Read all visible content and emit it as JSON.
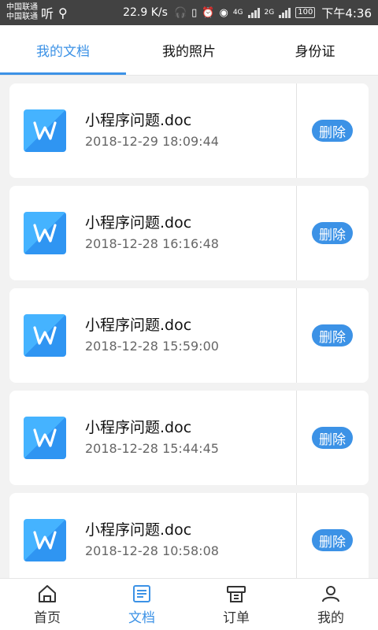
{
  "status_bar": {
    "carrier_1": "中国联通",
    "carrier_2": "中国联通",
    "extra_text": "听",
    "speed": "22.9 K/s",
    "network_1": "4G",
    "network_2": "2G",
    "battery": "100",
    "time": "下午4:36"
  },
  "tabs": [
    {
      "label": "我的文档",
      "active": true
    },
    {
      "label": "我的照片",
      "active": false
    },
    {
      "label": "身份证",
      "active": false
    }
  ],
  "documents": [
    {
      "name": "小程序问题.doc",
      "date": "2018-12-29 18:09:44",
      "delete_label": "删除"
    },
    {
      "name": "小程序问题.doc",
      "date": "2018-12-28 16:16:48",
      "delete_label": "删除"
    },
    {
      "name": "小程序问题.doc",
      "date": "2018-12-28 15:59:00",
      "delete_label": "删除"
    },
    {
      "name": "小程序问题.doc",
      "date": "2018-12-28 15:44:45",
      "delete_label": "删除"
    },
    {
      "name": "小程序问题.doc",
      "date": "2018-12-28 10:58:08",
      "delete_label": "删除"
    }
  ],
  "bottom_nav": [
    {
      "label": "首页",
      "icon": "home-icon",
      "active": false
    },
    {
      "label": "文档",
      "icon": "document-icon",
      "active": true
    },
    {
      "label": "订单",
      "icon": "order-icon",
      "active": false
    },
    {
      "label": "我的",
      "icon": "user-icon",
      "active": false
    }
  ],
  "colors": {
    "accent": "#3c92e6",
    "doc_icon": "#45b3ff",
    "status_bar": "#424242",
    "page_bg": "#f2f2f2"
  }
}
